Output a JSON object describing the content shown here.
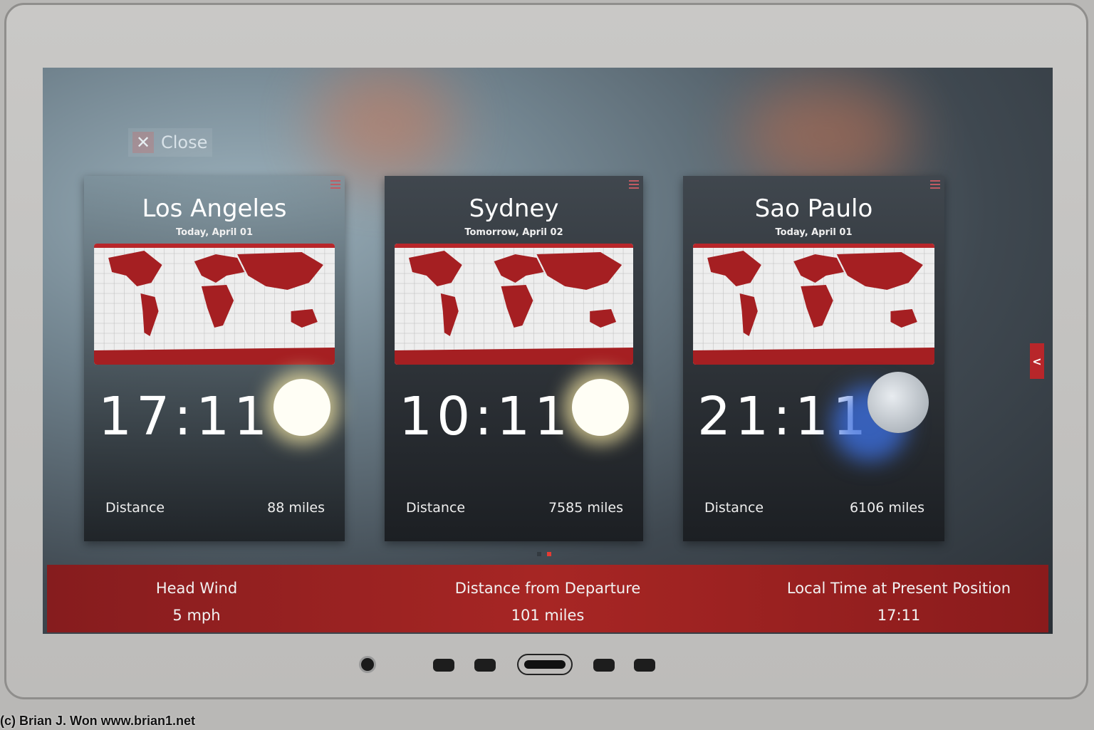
{
  "close_label": "Close",
  "accent": "#b8262a",
  "cards": [
    {
      "city": "Los Angeles",
      "date": "Today,  April 01",
      "time": "17:11",
      "icon": "sun-icon",
      "distance_label": "Distance",
      "distance": "88  miles"
    },
    {
      "city": "Sydney",
      "date": "Tomorrow,  April 02",
      "time": "10:11",
      "icon": "sun-icon",
      "distance_label": "Distance",
      "distance": "7585  miles"
    },
    {
      "city": "Sao Paulo",
      "date": "Today,  April 01",
      "time": "21:11",
      "icon": "moon-icon",
      "distance_label": "Distance",
      "distance": "6106  miles"
    }
  ],
  "page_indicator": {
    "pages": 2,
    "current": 2
  },
  "info_bar": [
    {
      "label": "Head Wind",
      "value": "5 mph"
    },
    {
      "label": "Distance from Departure",
      "value": "101 miles"
    },
    {
      "label": "Local Time at Present Position",
      "value": "17:11"
    }
  ],
  "watermark": "(c) Brian J. Won www.brian1.net"
}
